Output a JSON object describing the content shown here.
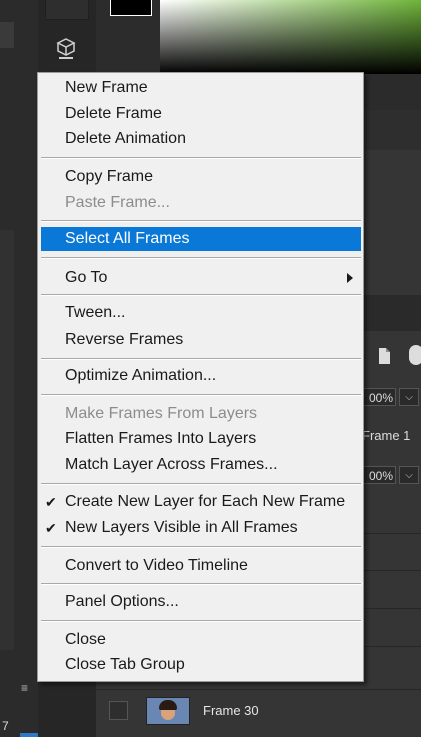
{
  "menu": {
    "items": [
      {
        "label": "New Frame",
        "enabled": true
      },
      {
        "label": "Delete Frame",
        "enabled": true
      },
      {
        "label": "Delete Animation",
        "enabled": true
      },
      {
        "label": "Copy Frame",
        "enabled": true
      },
      {
        "label": "Paste Frame...",
        "enabled": false
      },
      {
        "label": "Select All Frames",
        "enabled": true,
        "highlighted": true
      },
      {
        "label": "Go To",
        "enabled": true,
        "submenu": true
      },
      {
        "label": "Tween...",
        "enabled": true
      },
      {
        "label": "Reverse Frames",
        "enabled": true
      },
      {
        "label": "Optimize Animation...",
        "enabled": true
      },
      {
        "label": "Make Frames From Layers",
        "enabled": false
      },
      {
        "label": "Flatten Frames Into Layers",
        "enabled": true
      },
      {
        "label": "Match Layer Across Frames...",
        "enabled": true
      },
      {
        "label": "Create New Layer for Each New Frame",
        "enabled": true,
        "checked": true
      },
      {
        "label": "New Layers Visible in All Frames",
        "enabled": true,
        "checked": true
      },
      {
        "label": "Convert to Video Timeline",
        "enabled": true
      },
      {
        "label": "Panel Options...",
        "enabled": true
      },
      {
        "label": "Close",
        "enabled": true
      },
      {
        "label": "Close Tab Group",
        "enabled": true
      }
    ],
    "check_glyph": "✔"
  },
  "background": {
    "opacity_value": "00%",
    "fill_value": "00%",
    "layer_name_partial": "Frame 1",
    "frame_name": "Frame 30",
    "left_number": "7",
    "menu_icon": "≡"
  },
  "colors": {
    "highlight": "#0a78d7",
    "menu_bg": "#f0f0f0",
    "disabled_text": "#8c8c8c"
  }
}
